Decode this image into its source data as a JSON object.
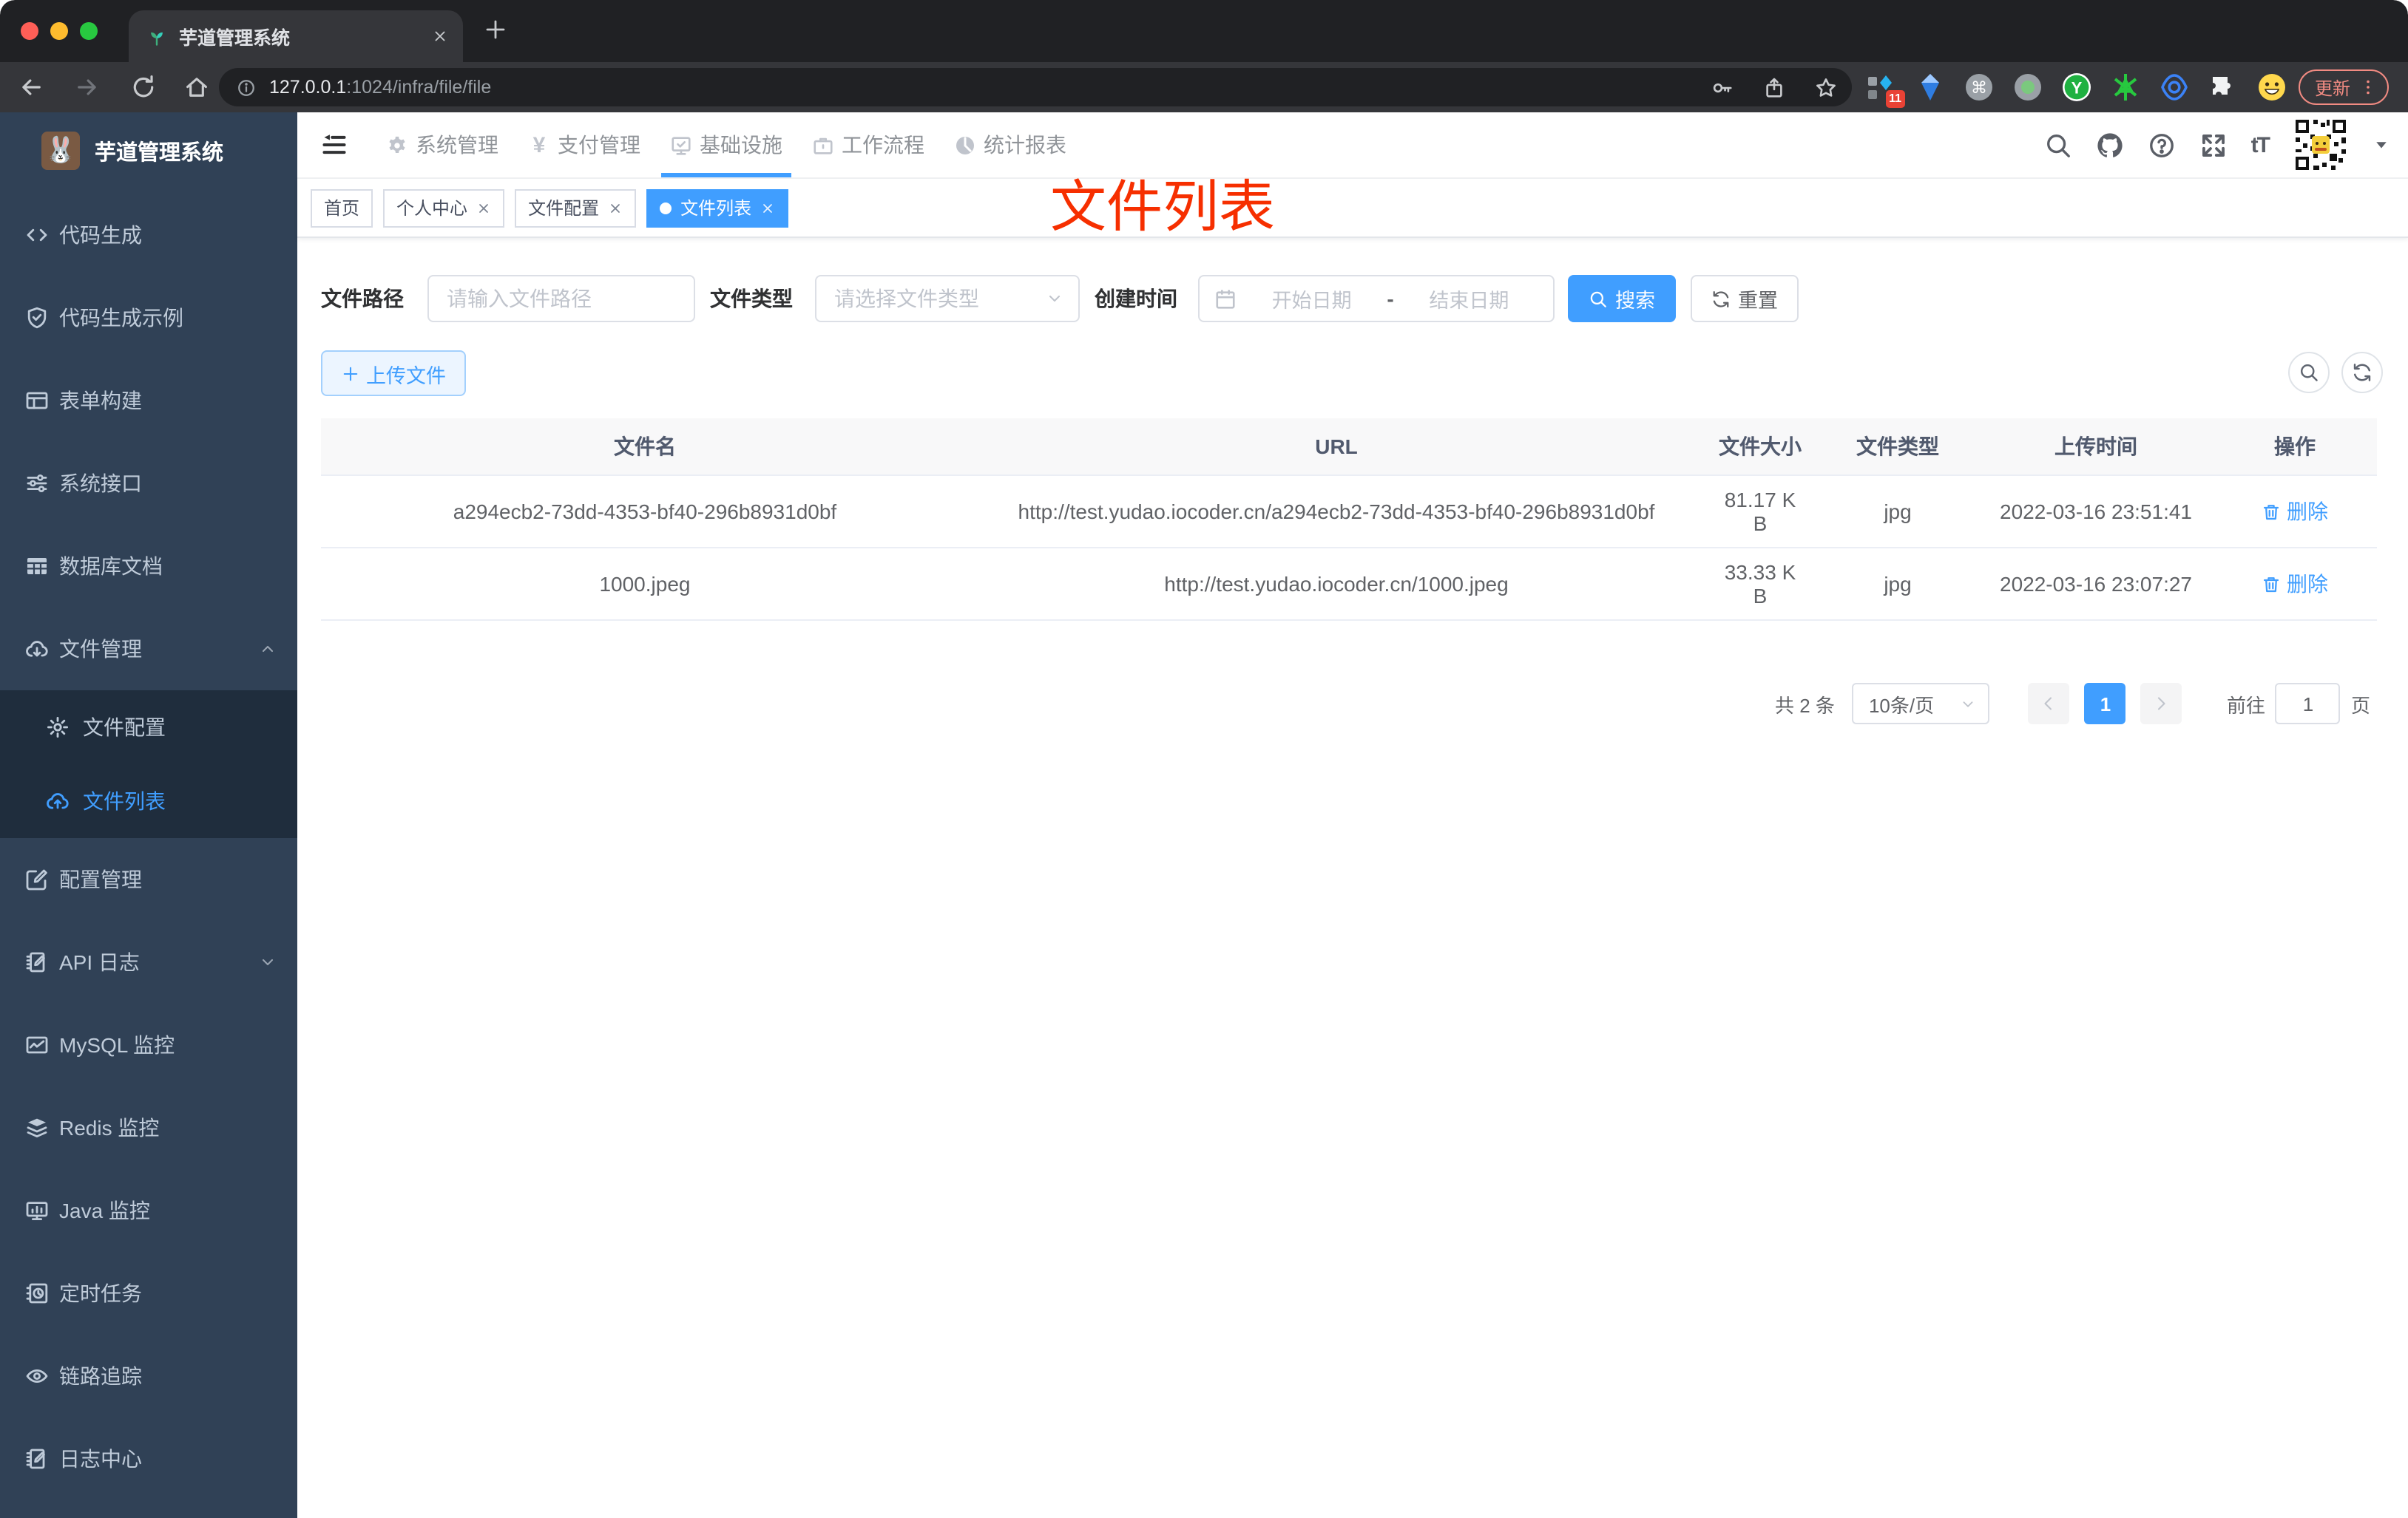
{
  "browser": {
    "tab_title": "芋道管理系统",
    "url_host": "127.0.0.1",
    "url_path": ":1024/infra/file/file",
    "extension_badge": "11",
    "update_label": "更新"
  },
  "sidebar": {
    "logo_title": "芋道管理系统",
    "logo_emoji": "🐰",
    "menu": [
      {
        "icon": "code",
        "label": "代码生成"
      },
      {
        "icon": "shield-check",
        "label": "代码生成示例"
      },
      {
        "icon": "form",
        "label": "表单构建"
      },
      {
        "icon": "sliders",
        "label": "系统接口"
      },
      {
        "icon": "grid",
        "label": "数据库文档"
      },
      {
        "icon": "cloud-download",
        "label": "文件管理",
        "state": "expanded",
        "children": [
          {
            "icon": "gear",
            "label": "文件配置"
          },
          {
            "icon": "cloud-upload",
            "label": "文件列表",
            "active": true
          }
        ]
      },
      {
        "icon": "edit-square",
        "label": "配置管理"
      },
      {
        "icon": "log-edit",
        "label": "API 日志",
        "state": "collapsed"
      },
      {
        "icon": "chart",
        "label": "MySQL 监控"
      },
      {
        "icon": "layers",
        "label": "Redis 监控"
      },
      {
        "icon": "monitor",
        "label": "Java 监控"
      },
      {
        "icon": "schedule",
        "label": "定时任务"
      },
      {
        "icon": "eye",
        "label": "链路追踪"
      },
      {
        "icon": "log-edit",
        "label": "日志中心"
      }
    ]
  },
  "header": {
    "menus": [
      {
        "icon": "gear-solid",
        "label": "系统管理"
      },
      {
        "icon": "yen",
        "label": "支付管理"
      },
      {
        "icon": "monitor-check",
        "label": "基础设施",
        "active": true
      },
      {
        "icon": "briefcase",
        "label": "工作流程"
      },
      {
        "icon": "dashboard",
        "label": "统计报表"
      }
    ]
  },
  "tags": [
    {
      "label": "首页"
    },
    {
      "label": "个人中心",
      "closable": true
    },
    {
      "label": "文件配置",
      "closable": true
    },
    {
      "label": "文件列表",
      "closable": true,
      "active": true
    }
  ],
  "annotation": "文件列表",
  "filters": {
    "path_label": "文件路径",
    "path_placeholder": "请输入文件路径",
    "type_label": "文件类型",
    "type_placeholder": "请选择文件类型",
    "date_label": "创建时间",
    "date_start": "开始日期",
    "date_separator": "-",
    "date_end": "结束日期",
    "search_label": "搜索",
    "reset_label": "重置"
  },
  "toolbar": {
    "upload_label": "上传文件"
  },
  "table": {
    "columns": [
      "文件名",
      "URL",
      "文件大小",
      "文件类型",
      "上传时间",
      "操作"
    ],
    "rows": [
      {
        "name": "a294ecb2-73dd-4353-bf40-296b8931d0bf",
        "url": "http://test.yudao.iocoder.cn/a294ecb2-73dd-4353-bf40-296b8931d0bf",
        "size": "81.17 KB",
        "type": "jpg",
        "time": "2022-03-16 23:51:41",
        "action": "删除"
      },
      {
        "name": "1000.jpeg",
        "url": "http://test.yudao.iocoder.cn/1000.jpeg",
        "size": "33.33 KB",
        "type": "jpg",
        "time": "2022-03-16 23:07:27",
        "action": "删除"
      }
    ]
  },
  "pagination": {
    "total": "共 2 条",
    "page_size": "10条/页",
    "current_page": "1",
    "goto_label": "前往",
    "goto_value": "1",
    "unit_label": "页"
  },
  "colors": {
    "primary": "#409eff",
    "sidebar_bg": "#304156",
    "submenu_bg": "#1f2d3d",
    "sidebar_text": "#bfcbd9",
    "annotation_red": "#f62f00",
    "chrome_dark": "#202124",
    "chrome_tab": "#35363a",
    "update_red": "#f28b82"
  }
}
